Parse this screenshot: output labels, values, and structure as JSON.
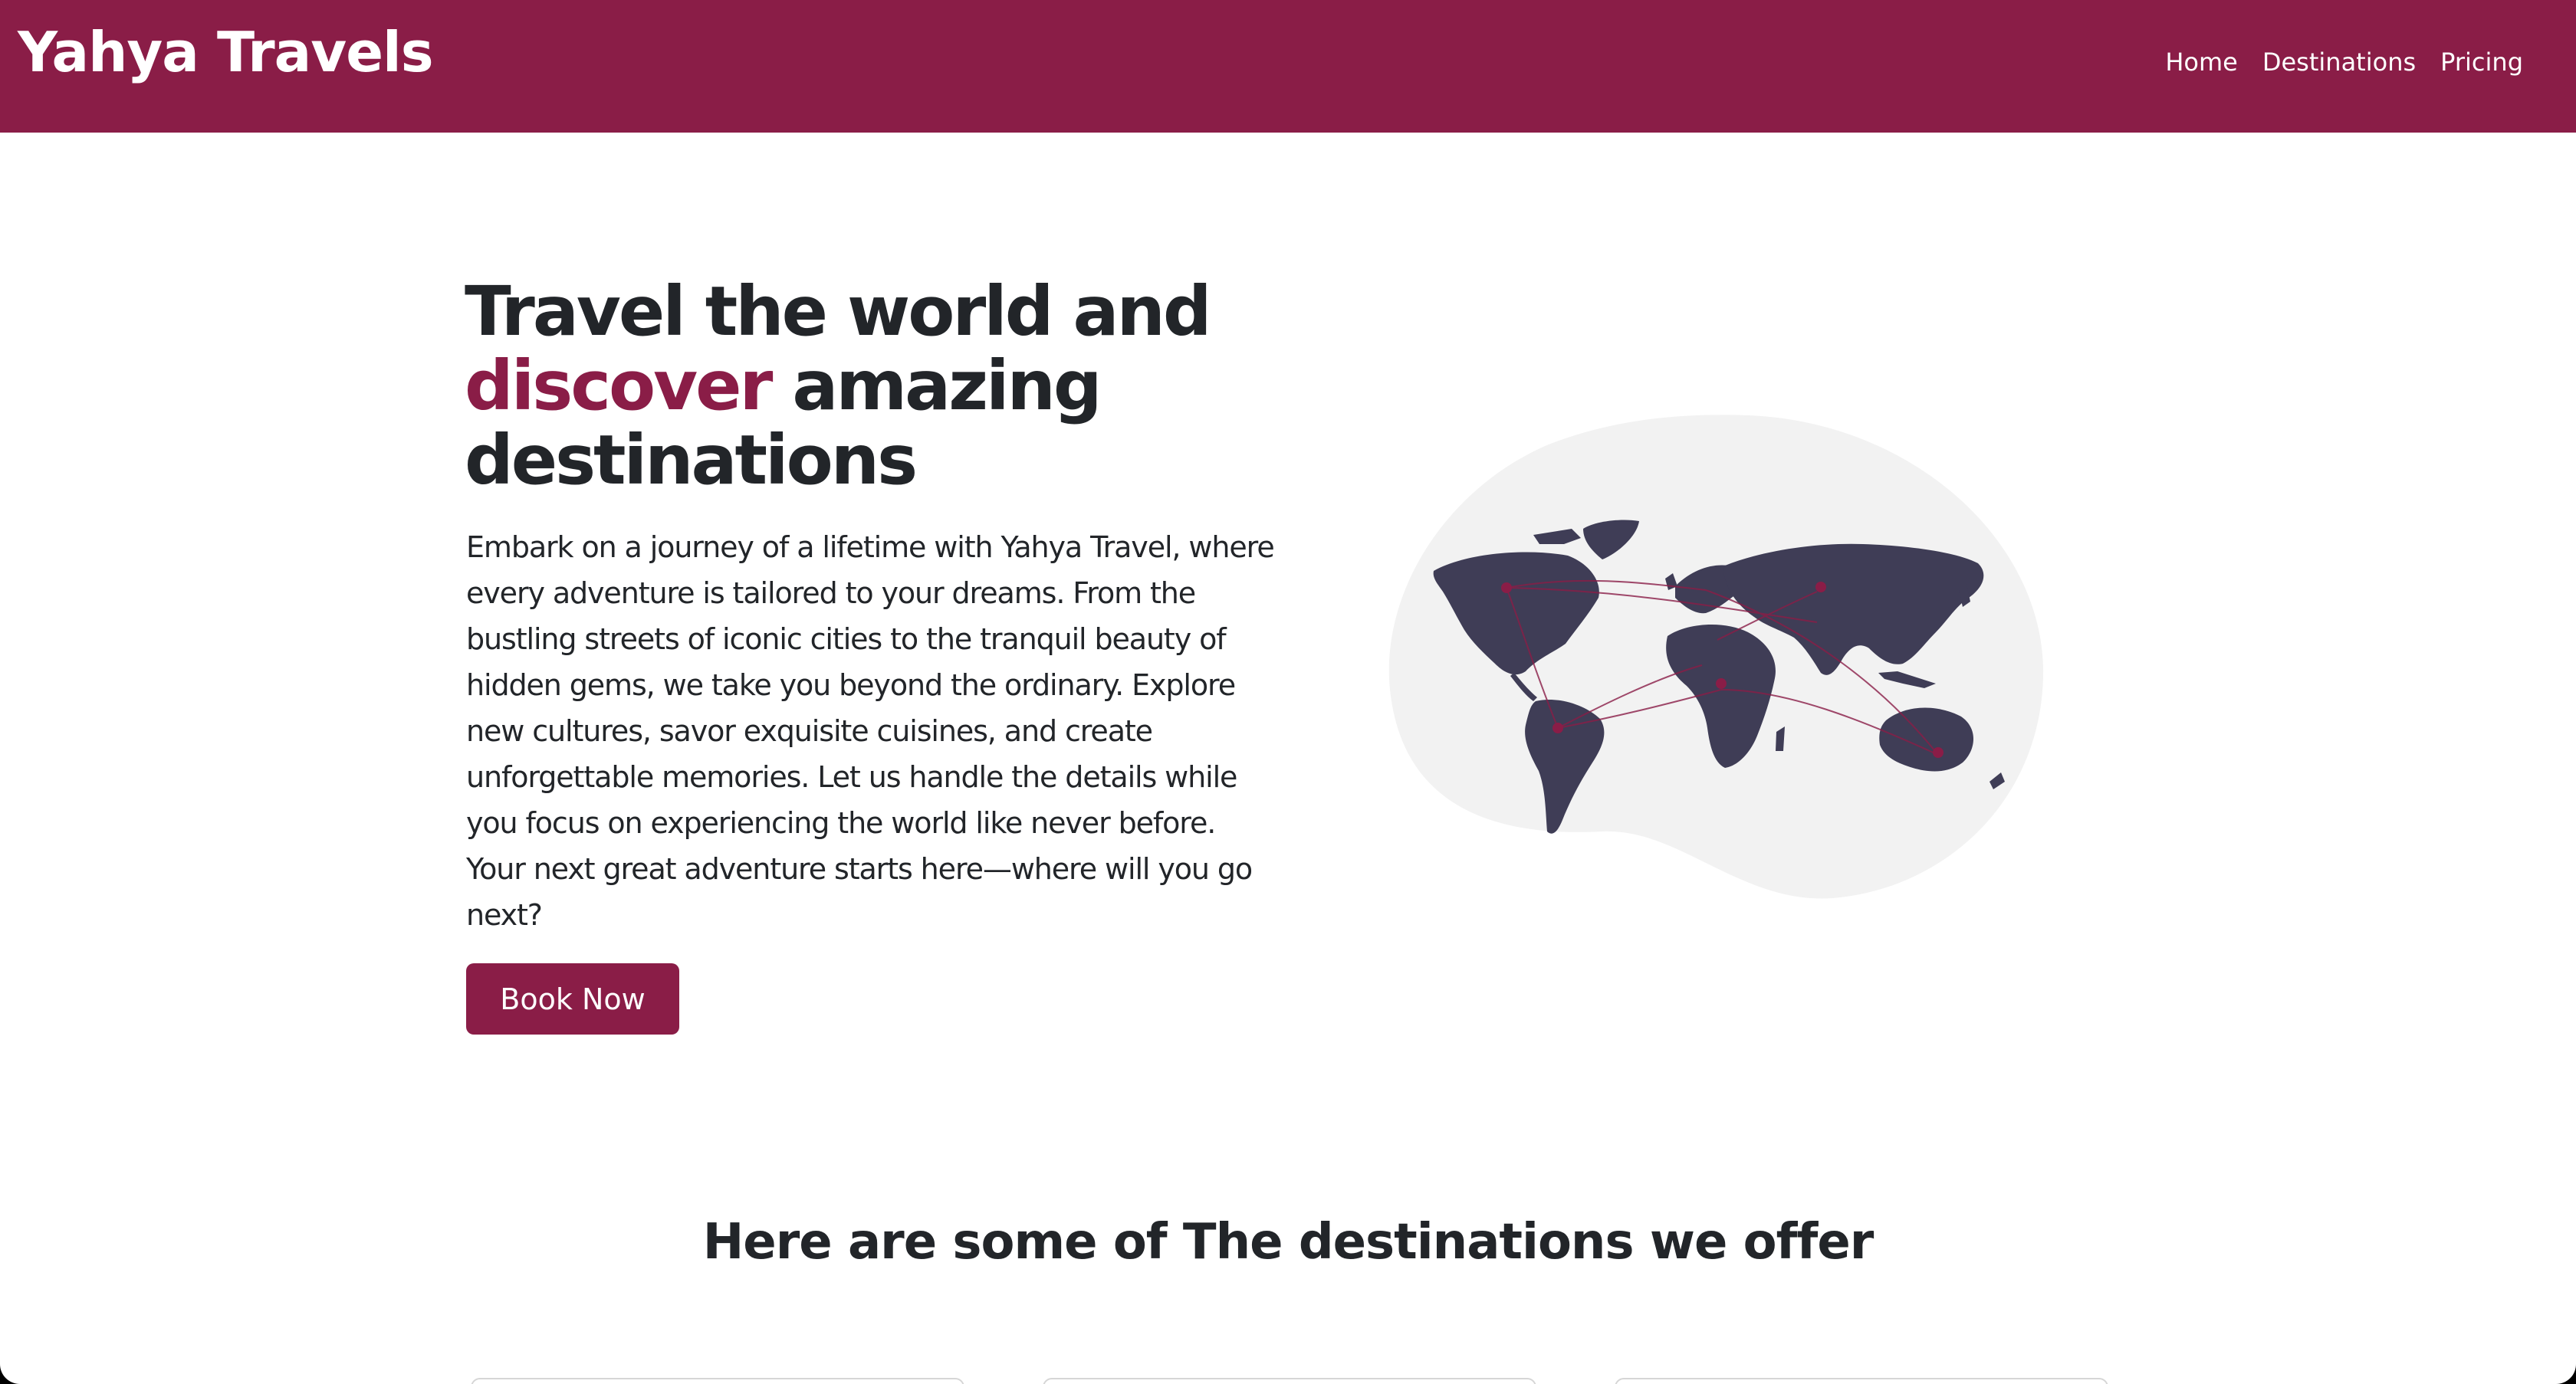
{
  "brand": {
    "name": "Yahya Travels"
  },
  "nav": {
    "items": [
      {
        "label": "Home"
      },
      {
        "label": "Destinations"
      },
      {
        "label": "Pricing"
      }
    ]
  },
  "hero": {
    "title_part1": "Travel the world and",
    "title_accent": "discover",
    "title_part2": " amazing",
    "title_part3": "destinations",
    "description": "Embark on a journey of a lifetime with Yahya Travel, where every adventure is tailored to your dreams. From the bustling streets of iconic cities to the tranquil beauty of hidden gems, we take you beyond the ordinary. Explore new cultures, savor exquisite cuisines, and create unforgettable memories. Let us handle the details while you focus on experiencing the world like never before. Your next great adventure starts here—where will you go next?",
    "cta_label": "Book Now",
    "illustration": "world-map-illustration"
  },
  "destinations": {
    "heading": "Here are some of The destinations we offer",
    "card_count": 3
  },
  "colors": {
    "brand": "#8a1d47",
    "text": "#222529",
    "map_land": "#3f3d56",
    "blob": "#f2f2f2"
  }
}
